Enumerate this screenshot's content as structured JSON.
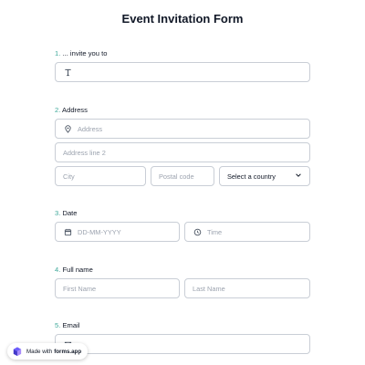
{
  "form": {
    "title": "Event Invitation Form"
  },
  "questions": [
    {
      "number": "1.",
      "label": "... invite you to"
    },
    {
      "number": "2.",
      "label": "Address"
    },
    {
      "number": "3.",
      "label": "Date"
    },
    {
      "number": "4.",
      "label": "Full name"
    },
    {
      "number": "5.",
      "label": "Email"
    }
  ],
  "address": {
    "line1_placeholder": "Address",
    "line2_placeholder": "Address line 2",
    "city_placeholder": "City",
    "postal_placeholder": "Postal code",
    "country_selected": "Select a country"
  },
  "date": {
    "date_placeholder": "DD-MM-YYYY",
    "time_placeholder": "Time"
  },
  "name": {
    "first_placeholder": "First Name",
    "last_placeholder": "Last Name"
  },
  "badge": {
    "text": "Made with",
    "brand": "forms.app"
  },
  "icons": {
    "text": "text-icon",
    "location": "location-pin-icon",
    "calendar": "calendar-icon",
    "clock": "clock-icon",
    "chevron": "chevron-down-icon",
    "email": "email-icon"
  },
  "colors": {
    "question_number": "#3ea89a",
    "border": "#c9ced6"
  }
}
